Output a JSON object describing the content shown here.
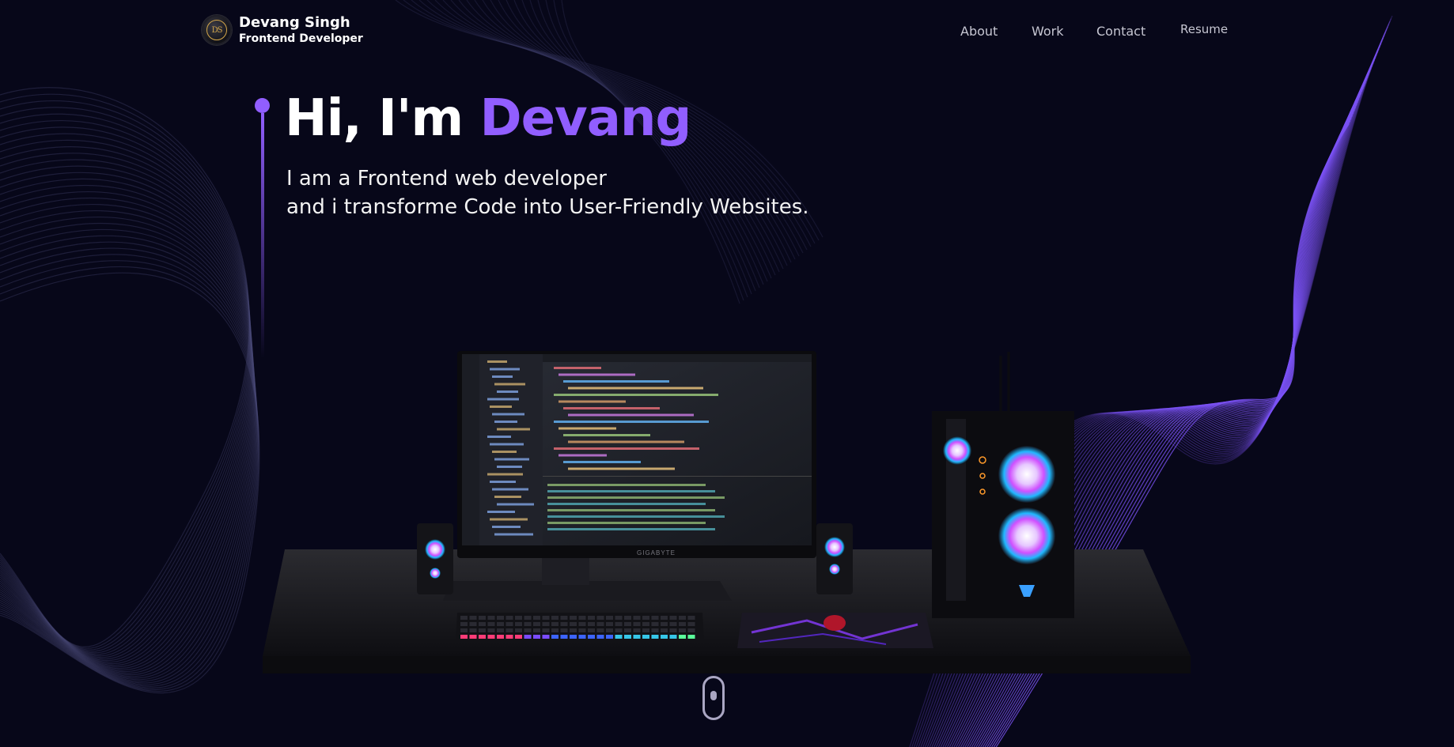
{
  "brand": {
    "name": "Devang Singh",
    "role": "Frontend Developer",
    "initials": "DS"
  },
  "nav": {
    "links": [
      {
        "label": "About"
      },
      {
        "label": "Work"
      },
      {
        "label": "Contact"
      },
      {
        "label": "Resume"
      }
    ]
  },
  "hero": {
    "greeting": "Hi, I'm ",
    "name": "Devang",
    "line1": "I am a Frontend web developer",
    "line2": "and i transforme Code into User-Friendly Websites."
  },
  "monitor_brand": "GIGABYTE",
  "colors": {
    "background": "#070719",
    "accent": "#915eff",
    "text": "#ffffff",
    "nav_text": "#c6c6d2"
  },
  "icons": [
    "logo-badge",
    "scroll-mouse-icon"
  ]
}
